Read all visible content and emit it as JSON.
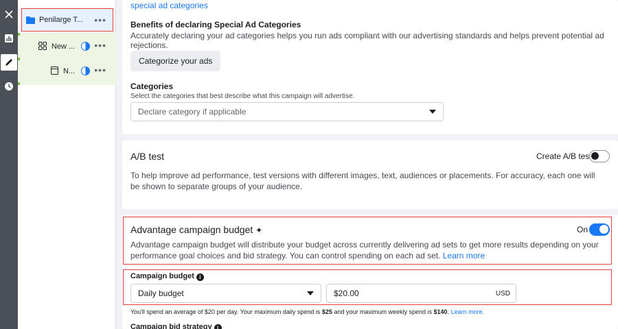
{
  "rail": {
    "icons": [
      "close-icon",
      "chart-icon",
      "pencil-icon",
      "clock-icon"
    ]
  },
  "tree": {
    "campaign": {
      "label": "Penilarge T...",
      "more": "•••"
    },
    "adset": {
      "label": "New ...",
      "more": "•••"
    },
    "ad": {
      "label": "N...",
      "more": "•••"
    }
  },
  "special_ad": {
    "top_link": "special ad categories",
    "benefits_title": "Benefits of declaring Special Ad Categories",
    "benefits_text": "Accurately declaring your ad categories helps you run ads compliant with our advertising standards and helps prevent potential ad rejections.",
    "categorize_button": "Categorize your ads",
    "categories_title": "Categories",
    "categories_help": "Select the categories that best describe what this campaign will advertise.",
    "categories_placeholder": "Declare category if applicable"
  },
  "ab_test": {
    "title": "A/B test",
    "toggle_label": "Create A/B test",
    "description": "To help improve ad performance, test versions with different images, text, audiences or placements. For accuracy, each one will be shown to separate groups of your audience."
  },
  "budget": {
    "title": "Advantage campaign budget",
    "sparkle": "✦",
    "toggle_label": "On",
    "description": "Advantage campaign budget will distribute your budget across currently delivering ad sets to get more results depending on your performance goal choices and bid strategy. You can control spending on each ad set.",
    "learn_more": "Learn more",
    "campaign_budget_title": "Campaign budget",
    "budget_type": "Daily budget",
    "amount": "$20.00",
    "currency": "USD",
    "spend_note_pre": "You'll spend an average of $20 per day. Your maximum daily spend is ",
    "max_daily": "$25",
    "spend_note_mid": " and your maximum weekly spend is ",
    "max_weekly": "$140",
    "spend_note_end": ".",
    "spend_learn_more": "Learn more.",
    "bid_strategy_title": "Campaign bid strategy"
  },
  "colors": {
    "accent": "#1877f2",
    "highlight": "#e04040",
    "tree_green": "#7cbf3f"
  }
}
